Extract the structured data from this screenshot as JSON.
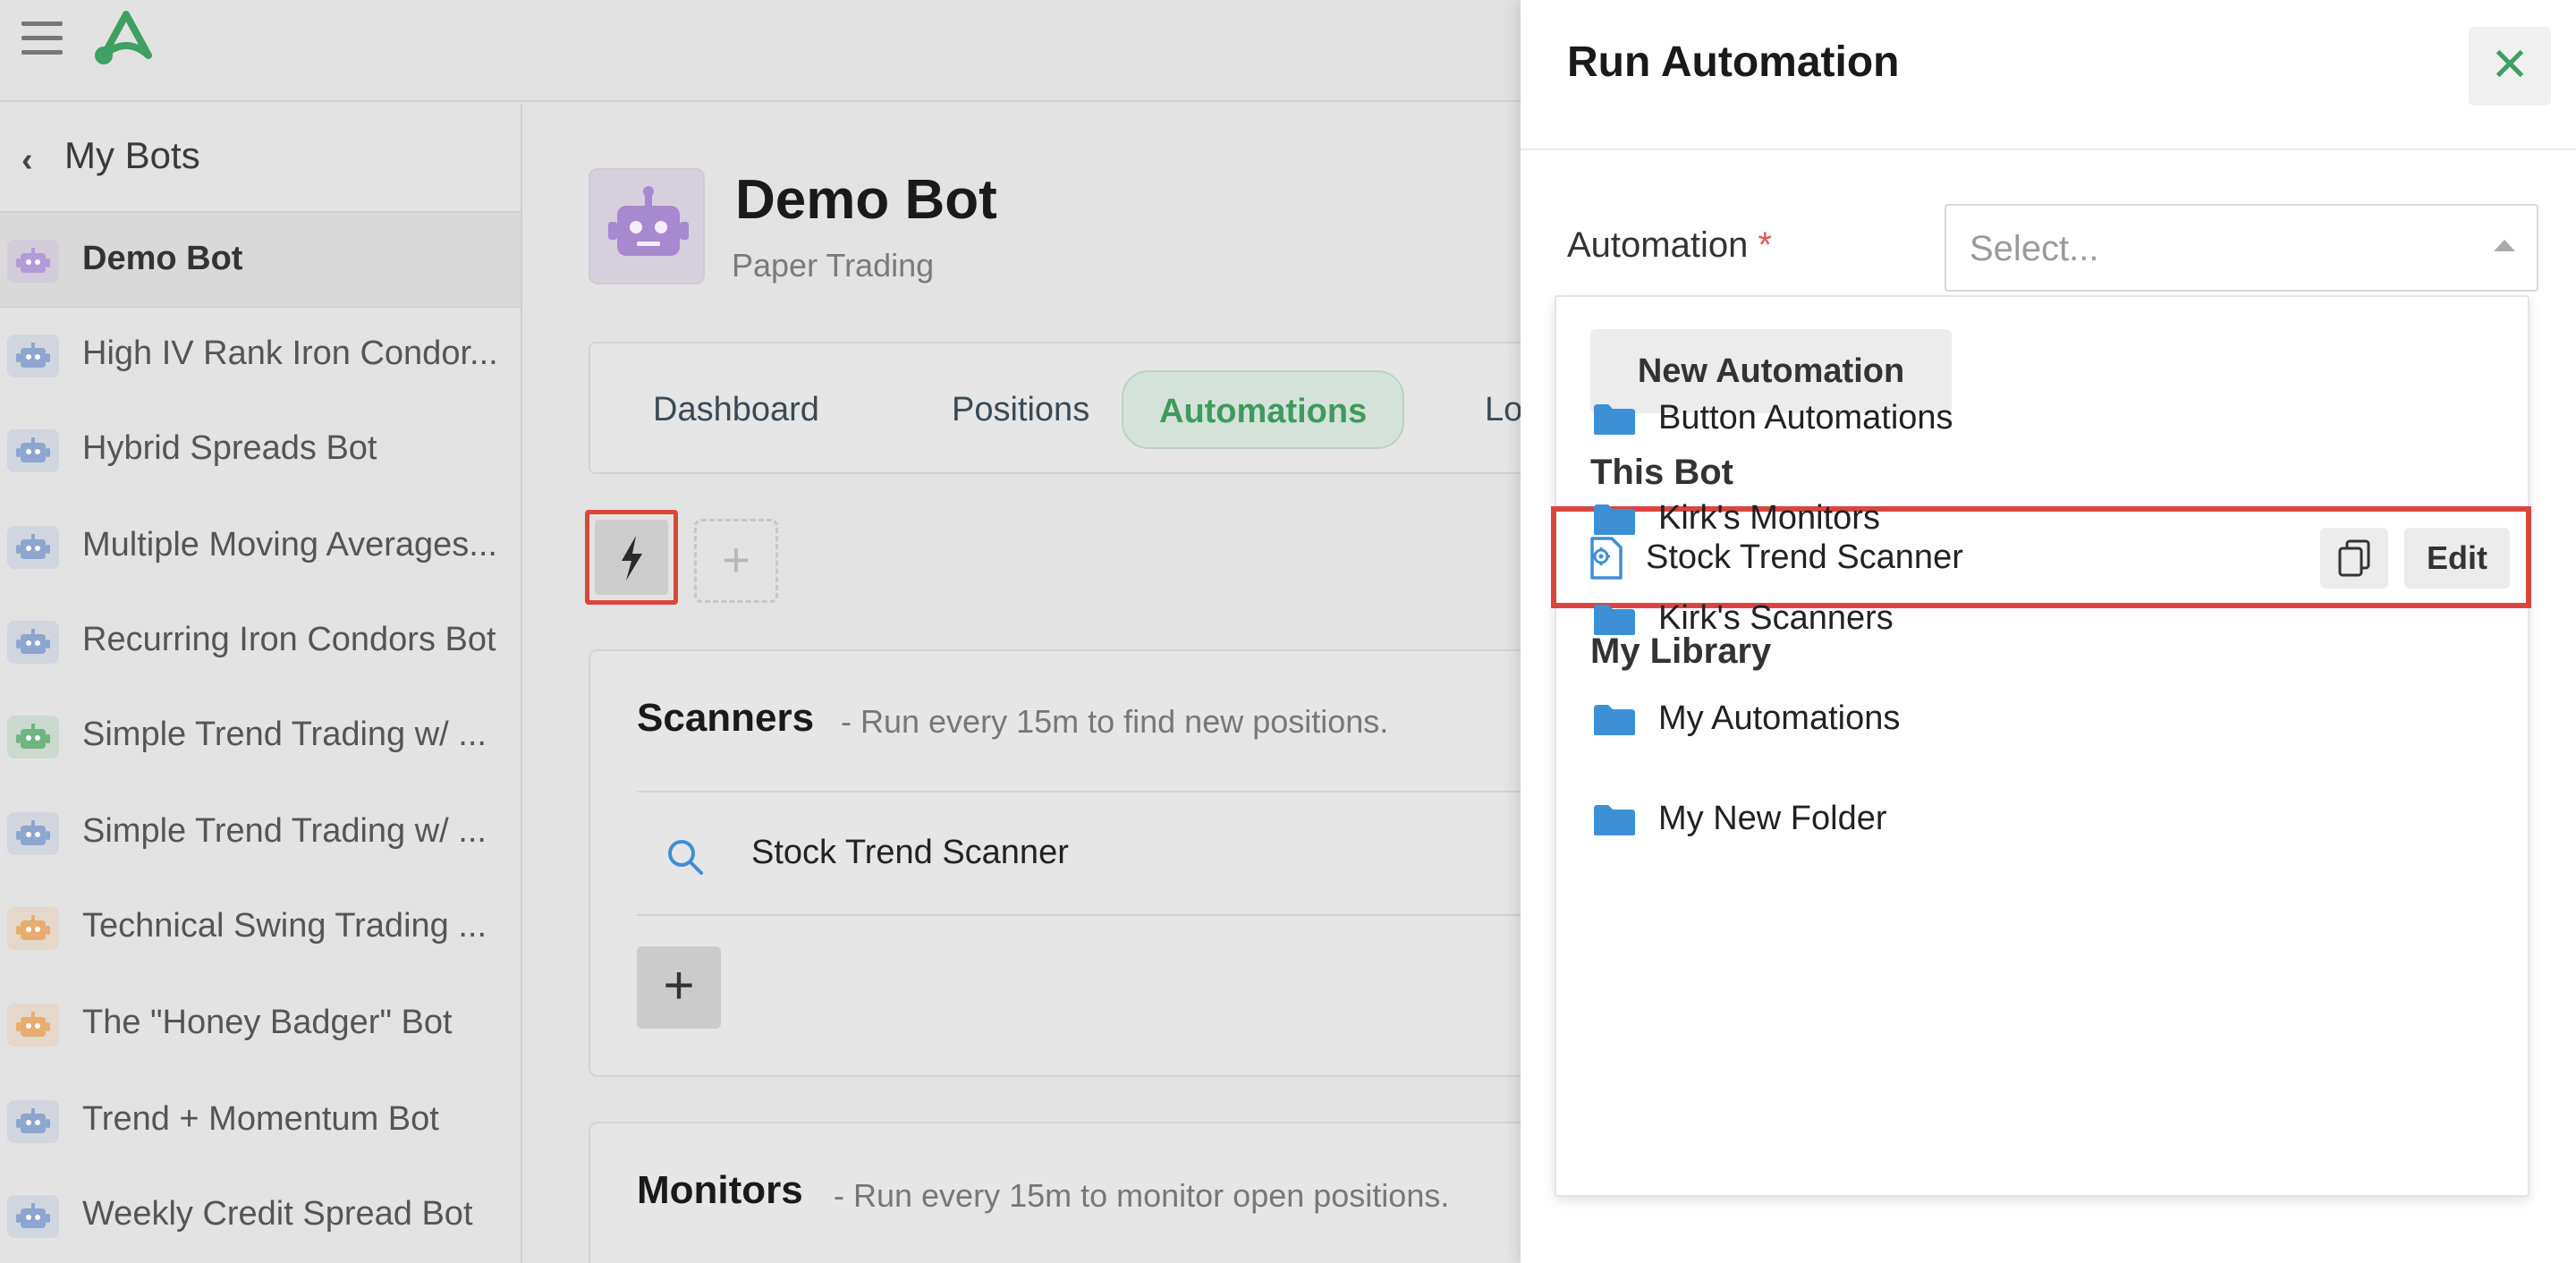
{
  "sidebar": {
    "back_label": "My Bots",
    "bots": [
      {
        "label": "Demo Bot",
        "color": "#b39ad9",
        "active": true
      },
      {
        "label": "High IV Rank Iron Condor...",
        "color": "#8ca6cf"
      },
      {
        "label": "Hybrid Spreads Bot",
        "color": "#8ca6cf"
      },
      {
        "label": "Multiple Moving Averages...",
        "color": "#8ca6cf"
      },
      {
        "label": "Recurring Iron Condors Bot",
        "color": "#8ca6cf"
      },
      {
        "label": "Simple Trend Trading w/ ...",
        "color": "#6fb57f"
      },
      {
        "label": "Simple Trend Trading w/ ...",
        "color": "#8ca6cf"
      },
      {
        "label": "Technical Swing Trading ...",
        "color": "#e7ad70"
      },
      {
        "label": "The \"Honey Badger\" Bot",
        "color": "#e7ad70"
      },
      {
        "label": "Trend + Momentum Bot",
        "color": "#8ca6cf"
      },
      {
        "label": "Weekly Credit Spread Bot",
        "color": "#8ca6cf"
      }
    ]
  },
  "main": {
    "title": "Demo Bot",
    "subtitle": "Paper Trading",
    "tabs": [
      {
        "label": "Dashboard"
      },
      {
        "label": "Positions"
      },
      {
        "label": "Automations",
        "active": true
      },
      {
        "label": "Lo"
      }
    ],
    "scanners": {
      "title": "Scanners",
      "desc": "- Run every 15m to find new positions.",
      "row_label": "Stock Trend Scanner"
    },
    "monitors": {
      "title": "Monitors",
      "desc": "- Run every 15m to monitor open positions."
    }
  },
  "panel": {
    "title": "Run Automation",
    "field_label": "Automation",
    "required_mark": "*",
    "select_placeholder": "Select...",
    "new_automation_label": "New Automation",
    "this_bot_heading": "This Bot",
    "this_bot_item": "Stock Trend Scanner",
    "edit_label": "Edit",
    "library_heading": "My Library",
    "folders": [
      {
        "label": "Button Automations"
      },
      {
        "label": "Kirk's Monitors"
      },
      {
        "label": "Kirk's Scanners"
      },
      {
        "label": "My Automations"
      },
      {
        "label": "My New Folder"
      }
    ]
  },
  "colors": {
    "accent_green": "#3e9a5e",
    "highlight_red": "#d9473c",
    "folder_blue": "#3d8fd6"
  }
}
